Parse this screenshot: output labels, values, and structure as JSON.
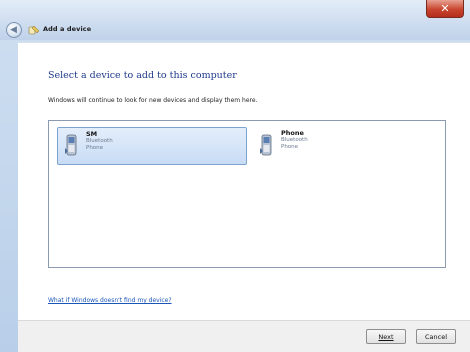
{
  "window": {
    "title": "Add a device"
  },
  "page": {
    "heading": "Select a device to add to this computer",
    "subtext": "Windows will continue to look for new devices and display them here.",
    "help_link": "What if Windows doesn't find my device?"
  },
  "devices": [
    {
      "name": "SM",
      "type": "Bluetooth",
      "category": "Phone",
      "selected": true
    },
    {
      "name": "Phone",
      "type": "Bluetooth",
      "category": "Phone",
      "selected": false
    }
  ],
  "buttons": {
    "next_label": "Next",
    "cancel_label": "Cancel"
  },
  "icons": {
    "back": "back-arrow-icon",
    "title": "add-device-icon",
    "device": "phone-icon",
    "close": "close-icon"
  },
  "colors": {
    "heading": "#1e3a8a",
    "link": "#1a56b8",
    "selection": "#c8dcf5",
    "close": "#c9452f"
  }
}
